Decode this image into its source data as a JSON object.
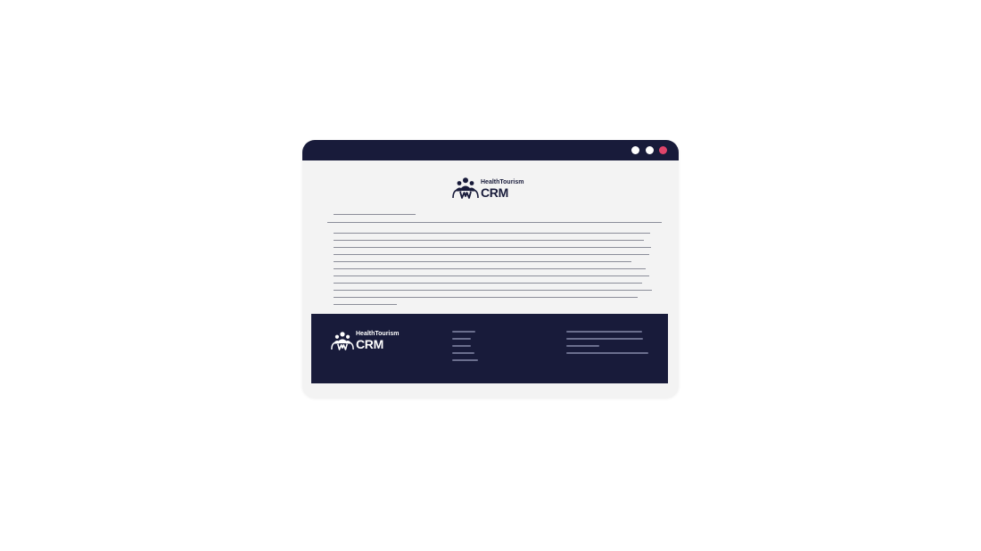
{
  "window": {
    "controls": [
      {
        "name": "minimize-dot",
        "color": "#ffffff"
      },
      {
        "name": "maximize-dot",
        "color": "#ffffff"
      },
      {
        "name": "close-dot",
        "color": "#e0456a"
      }
    ]
  },
  "header": {
    "logo_small": "HealthTourism",
    "logo_big": "CRM",
    "logo_icon": "people-group-icon"
  },
  "footer": {
    "logo_small": "HealthTourism",
    "logo_big": "CRM",
    "logo_icon": "people-group-icon"
  },
  "colors": {
    "navy": "#181b3a",
    "page": "#f3f3f3",
    "text_line": "#8b8d99",
    "footer_line": "#6b6f8e",
    "close": "#e0456a"
  }
}
